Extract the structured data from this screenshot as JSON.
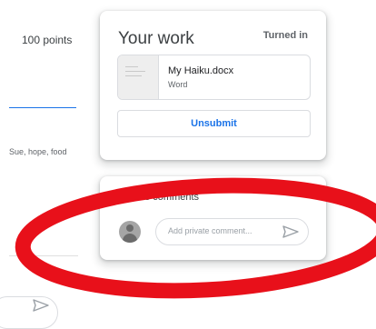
{
  "assignment": {
    "points": "100 points",
    "keywords": "Sue, hope, food"
  },
  "your_work": {
    "title": "Your work",
    "status": "Turned in",
    "attachment": {
      "name": "My Haiku.docx",
      "type": "Word",
      "thumbnail_icon": "document-thumbnail-icon"
    },
    "unsubmit_label": "Unsubmit"
  },
  "private_comments": {
    "title": "Private comments",
    "placeholder": "Add private comment...",
    "avatar_icon": "user-avatar-icon",
    "send_icon": "send-icon"
  },
  "annotation": {
    "color": "#e8101a"
  },
  "colors": {
    "accent": "#1a73e8",
    "text": "#3c4043",
    "muted": "#5f6368",
    "border": "#dadce0"
  }
}
